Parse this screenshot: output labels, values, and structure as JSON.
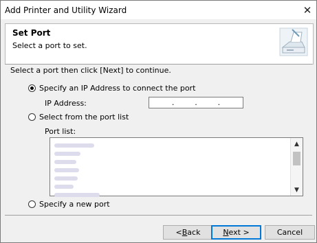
{
  "window": {
    "title": "Add Printer and Utility Wizard",
    "close_glyph": "✕"
  },
  "header": {
    "title": "Set Port",
    "subtitle": "Select a port to set.",
    "icon": "printer-wizard-icon"
  },
  "instruction": "Select a port then click [Next] to continue.",
  "options": {
    "ip": {
      "label": "Specify an IP Address to connect the port",
      "selected": true
    },
    "ip_field": {
      "label": "IP Address:",
      "value": "  .    .    .  "
    },
    "list": {
      "label": "Select from the port list",
      "selected": false
    },
    "port_list_label": "Port list:",
    "new": {
      "label": "Specify a new port",
      "selected": false
    }
  },
  "buttons": {
    "back": {
      "pre": "< ",
      "mnemonic": "B",
      "post": "ack"
    },
    "next": {
      "pre": "",
      "mnemonic": "N",
      "post": "ext >"
    },
    "cancel": "Cancel"
  }
}
